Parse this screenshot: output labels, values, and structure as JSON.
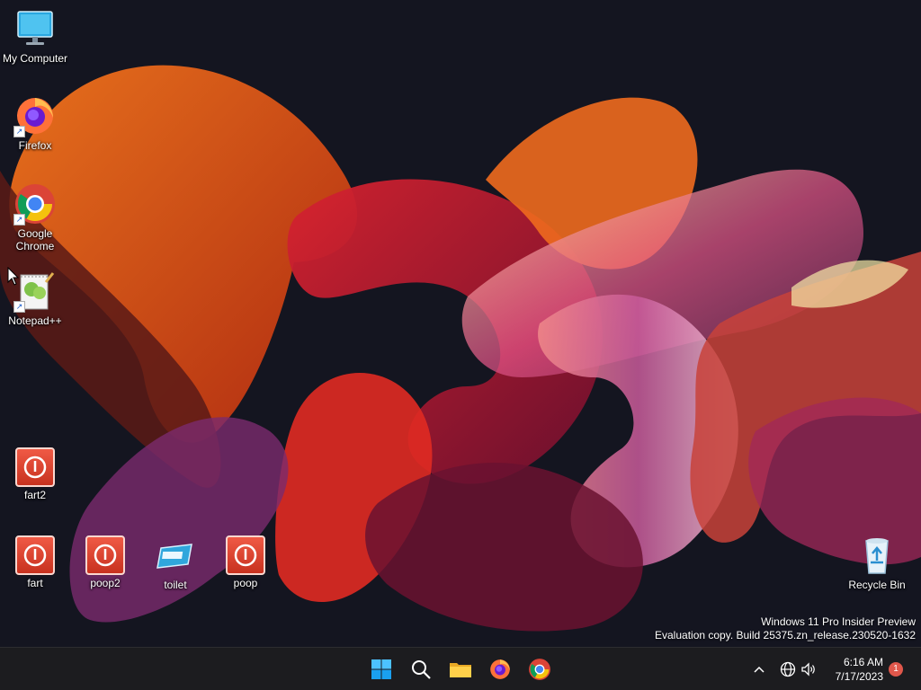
{
  "desktop": {
    "icons": [
      {
        "label": "My Computer",
        "icon": "monitor-icon"
      },
      {
        "label": "Firefox",
        "icon": "firefox-icon"
      },
      {
        "label": "Google Chrome",
        "icon": "chrome-icon"
      },
      {
        "label": "Notepad++",
        "icon": "notepad-plus-plus-icon"
      },
      {
        "label": "fart2",
        "icon": "power-icon"
      },
      {
        "label": "fart",
        "icon": "power-icon"
      },
      {
        "label": "poop2",
        "icon": "power-icon"
      },
      {
        "label": "toilet",
        "icon": "toilet-icon"
      },
      {
        "label": "poop",
        "icon": "power-icon"
      },
      {
        "label": "Recycle Bin",
        "icon": "recycle-bin-icon"
      }
    ],
    "shortcut_arrow": "↗",
    "watermark": {
      "line1": "Windows 11 Pro Insider Preview",
      "line2": "Evaluation copy. Build 25375.zn_release.230520-1632"
    },
    "colors": {
      "power_tile": "#e8493a",
      "taskbar": "#1c1c1f",
      "accent": "#0078d4"
    }
  },
  "taskbar": {
    "apps": [
      "start-icon",
      "search-icon",
      "file-explorer-icon",
      "firefox-icon",
      "chrome-icon"
    ],
    "tray": {
      "time": "6:16 AM",
      "date": "7/17/2023",
      "notification_count": "1"
    }
  }
}
